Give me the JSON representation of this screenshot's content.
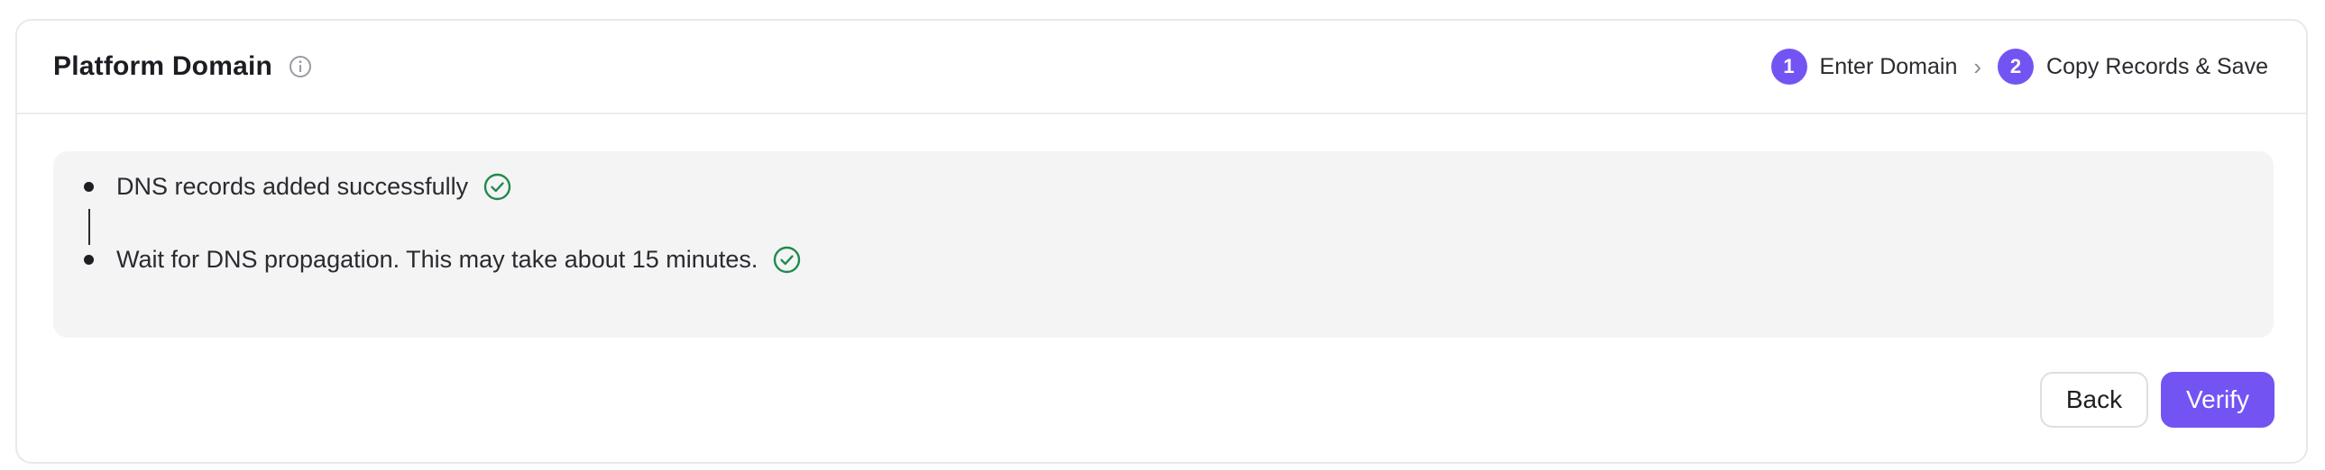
{
  "header": {
    "title": "Platform Domain",
    "info_icon": "info-icon"
  },
  "steps": [
    {
      "number": "1",
      "label": "Enter Domain"
    },
    {
      "number": "2",
      "label": "Copy Records & Save"
    }
  ],
  "status": {
    "items": [
      {
        "text": "DNS records added successfully",
        "icon": "check-circle-icon",
        "state": "success"
      },
      {
        "text": "Wait for DNS propagation. This may take about 15 minutes.",
        "icon": "check-circle-icon",
        "state": "success"
      }
    ]
  },
  "actions": {
    "back_label": "Back",
    "verify_label": "Verify"
  },
  "colors": {
    "accent": "#7354f3",
    "success": "#1f8a4c",
    "panel_bg": "#f4f4f5",
    "border": "#e8e8ec"
  }
}
